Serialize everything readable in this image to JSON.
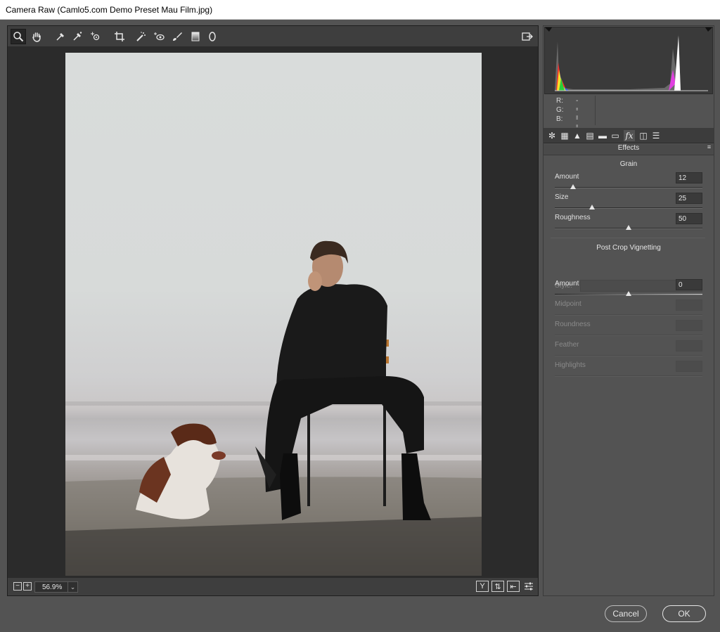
{
  "window": {
    "title": "Camera Raw (Camlo5.com Demo Preset Mau Film.jpg)"
  },
  "toolbar": {
    "tools": [
      "zoom-tool",
      "hand-tool",
      "white-balance-tool",
      "color-sampler-tool",
      "targeted-adjustment-tool",
      "crop-tool",
      "spot-removal-tool",
      "red-eye-tool",
      "adjustment-brush-tool",
      "graduated-filter-tool",
      "radial-filter-tool"
    ],
    "open_prefs": "open-preferences-icon"
  },
  "histogram": {
    "r_label": "R:",
    "g_label": "G:",
    "b_label": "B:",
    "r_value": "---",
    "g_value": "---",
    "b_value": "---"
  },
  "panel": {
    "title": "Effects",
    "grain": {
      "title": "Grain",
      "amount_label": "Amount",
      "amount_value": "12",
      "size_label": "Size",
      "size_value": "25",
      "roughness_label": "Roughness",
      "roughness_value": "50"
    },
    "vignette": {
      "title": "Post Crop Vignetting",
      "style_label": "Style:",
      "amount_label": "Amount",
      "amount_value": "0",
      "midpoint_label": "Midpoint",
      "roundness_label": "Roundness",
      "feather_label": "Feather",
      "highlights_label": "Highlights"
    }
  },
  "statusbar": {
    "zoom": "56.9%",
    "zoom_out": "−",
    "zoom_in": "+"
  },
  "buttons": {
    "cancel": "Cancel",
    "ok": "OK"
  },
  "colors": {
    "panel_bg": "#535353",
    "dark_bg": "#2b2b2b",
    "toolbar_bg": "#3e3e3e"
  }
}
